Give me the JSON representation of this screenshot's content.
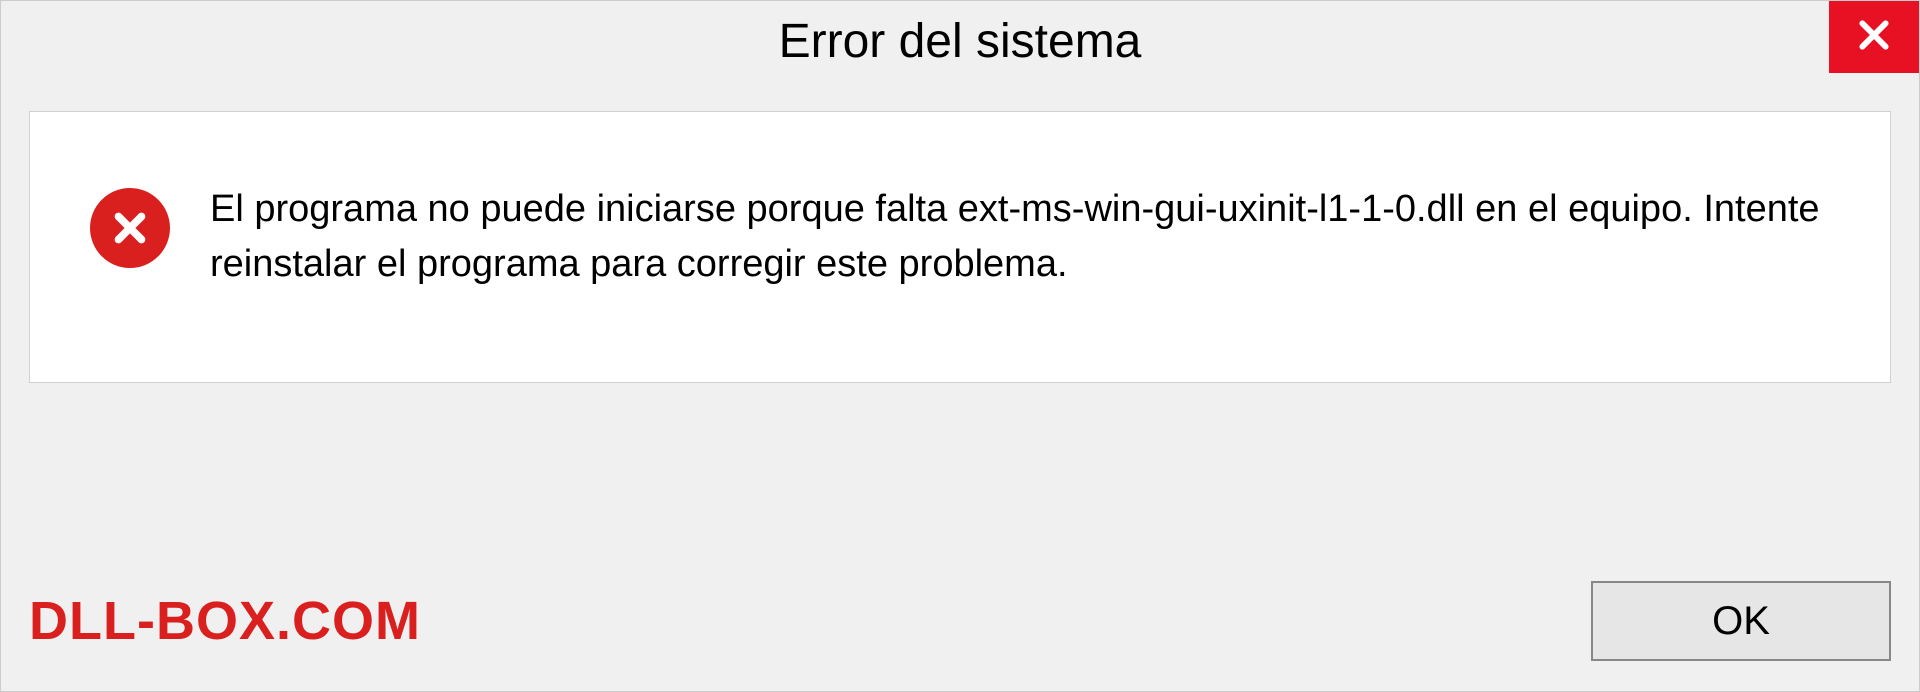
{
  "dialog": {
    "title": "Error del sistema",
    "message": "El programa no puede iniciarse porque falta ext-ms-win-gui-uxinit-l1-1-0.dll en el equipo. Intente reinstalar el programa para corregir este problema.",
    "ok_label": "OK"
  },
  "watermark": "DLL-BOX.COM",
  "colors": {
    "error_red": "#d9201e",
    "close_red": "#e81123"
  }
}
